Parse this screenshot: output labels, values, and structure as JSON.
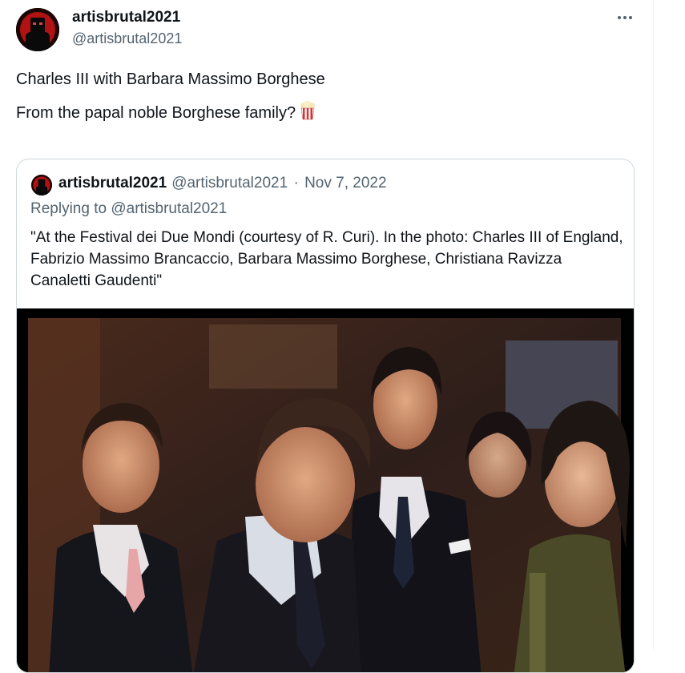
{
  "tweet": {
    "display_name": "artisbrutal2021",
    "handle": "@artisbrutal2021",
    "text_line1": "Charles III with Barbara Massimo Borghese",
    "text_line2": "From the papal noble Borghese family?",
    "emoji": "popcorn"
  },
  "quoted_tweet": {
    "display_name": "artisbrutal2021",
    "handle": "@artisbrutal2021",
    "separator": "·",
    "date": "Nov 7, 2022",
    "replying_to": "Replying to @artisbrutal2021",
    "text": "\"At the Festival dei Due Mondi (courtesy of R. Curi). In the photo: Charles III of England, Fabrizio Massimo Brancaccio, Barbara Massimo Borghese, Christiana Ravizza Canaletti Gaudenti\""
  },
  "colors": {
    "text_primary": "#0f1419",
    "text_secondary": "#536471",
    "border": "#cfd9de"
  },
  "icons": [
    "more-icon",
    "popcorn-icon"
  ]
}
